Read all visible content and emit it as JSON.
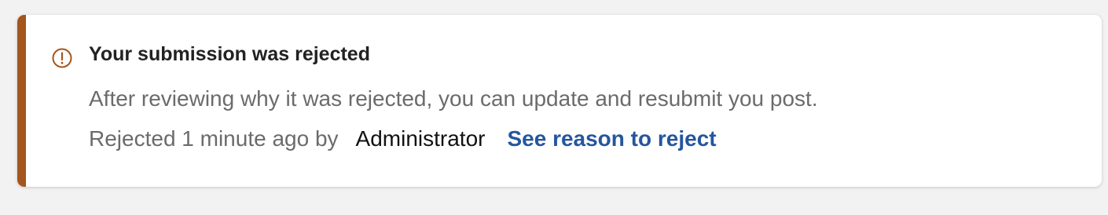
{
  "notice": {
    "icon": "alert-circle-icon",
    "accent_color": "#a4561c",
    "title": "Your submission was rejected",
    "description": "After reviewing why it was rejected, you can update and resubmit you post.",
    "meta": {
      "rejected_text": "Rejected 1 minute ago by",
      "user": "Administrator",
      "link_label": "See reason to reject",
      "link_color": "#25569d"
    }
  }
}
